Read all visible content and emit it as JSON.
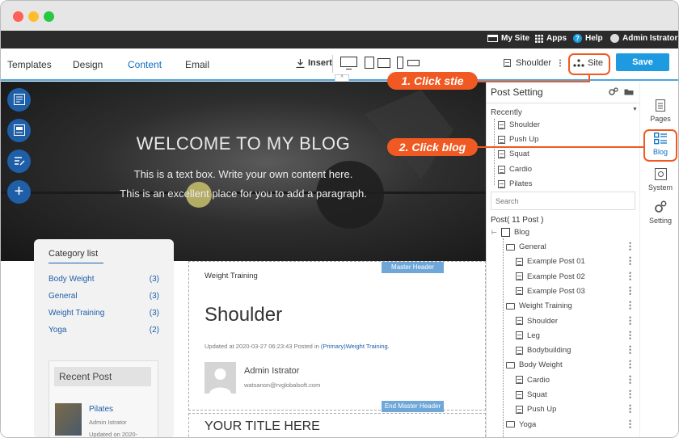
{
  "topbar": {
    "my_site": "My Site",
    "apps": "Apps",
    "help": "Help",
    "user": "Admin Istrator"
  },
  "toolbar": {
    "tabs": [
      "Templates",
      "Design",
      "Content",
      "Email"
    ],
    "insert": "Insert",
    "page_select": "Shoulder",
    "site": "Site",
    "save": "Save"
  },
  "hero": {
    "title": "WELCOME TO MY BLOG",
    "line1": "This is a text box. Write your own content here.",
    "line2": "This is an excellent place for you to add a paragraph."
  },
  "category": {
    "title": "Category list",
    "items": [
      {
        "name": "Body Weight",
        "count": "(3)"
      },
      {
        "name": "General",
        "count": "(3)"
      },
      {
        "name": "Weight Training",
        "count": "(3)"
      },
      {
        "name": "Yoga",
        "count": "(2)"
      }
    ]
  },
  "recent": {
    "title": "Recent Post",
    "post_title": "Pilates",
    "author": "Admin Istrator",
    "updated": "Updated on 2020-"
  },
  "article": {
    "master_header": "Master Header",
    "end_master_header": "End Master Header",
    "breadcrumb": "Weight Training",
    "title": "Shoulder",
    "meta": "Updated at 2020-03-27 06:23:43 Posted in",
    "meta_link": "(Primary)Weight Training.",
    "author": "Admin Istrator",
    "email": "watsanon@rvglobalsoft.com",
    "your_title": "YOUR TITLE HERE"
  },
  "panel": {
    "title": "Post Setting",
    "recently": "Recently",
    "recent_items": [
      "Shoulder",
      "Push Up",
      "Squat",
      "Cardio",
      "Pilates"
    ],
    "search_placeholder": "Search",
    "post_count": "Post( 11 Post )",
    "root": "Blog",
    "tree": [
      {
        "type": "folder",
        "label": "General",
        "level": 1
      },
      {
        "type": "file",
        "label": "Example Post 01",
        "level": 2
      },
      {
        "type": "file",
        "label": "Example Post 02",
        "level": 2
      },
      {
        "type": "file",
        "label": "Example Post 03",
        "level": 2
      },
      {
        "type": "folder",
        "label": "Weight Training",
        "level": 1
      },
      {
        "type": "file",
        "label": "Shoulder",
        "level": 2
      },
      {
        "type": "file",
        "label": "Leg",
        "level": 2
      },
      {
        "type": "file",
        "label": "Bodybuilding",
        "level": 2
      },
      {
        "type": "folder",
        "label": "Body Weight",
        "level": 1
      },
      {
        "type": "file",
        "label": "Cardio",
        "level": 2
      },
      {
        "type": "file",
        "label": "Squat",
        "level": 2
      },
      {
        "type": "file",
        "label": "Push Up",
        "level": 2
      },
      {
        "type": "folder",
        "label": "Yoga",
        "level": 1
      }
    ]
  },
  "rside": {
    "pages": "Pages",
    "blog": "Blog",
    "system": "System",
    "setting": "Setting"
  },
  "callouts": {
    "step1": "1. Click stie",
    "step2": "2. Click blog"
  },
  "colors": {
    "accent": "#0b6fc1",
    "callout": "#f05a22",
    "save": "#1e9be0"
  }
}
